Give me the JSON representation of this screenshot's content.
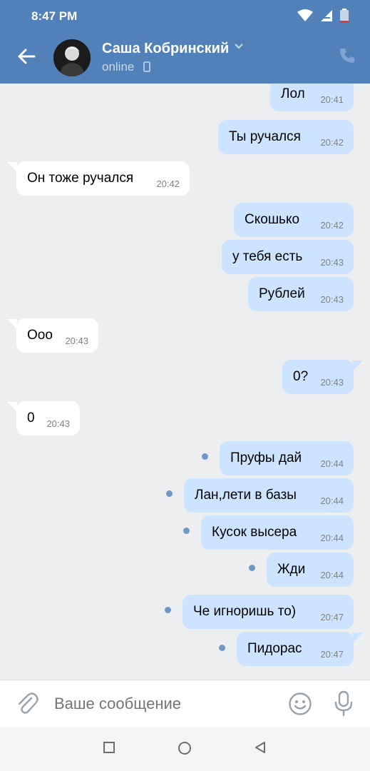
{
  "status": {
    "time": "8:47 PM"
  },
  "header": {
    "name": "Саша Кобринский",
    "status": "online"
  },
  "messages": [
    {
      "text": "Лол",
      "time": "20:41",
      "dir": "out"
    },
    {
      "text": "Ты ручался",
      "time": "20:42",
      "dir": "out"
    },
    {
      "text": "Он тоже ручался",
      "time": "20:42",
      "dir": "in"
    },
    {
      "text": "Скошько",
      "time": "20:42",
      "dir": "out"
    },
    {
      "text": "у тебя есть",
      "time": "20:43",
      "dir": "out"
    },
    {
      "text": "Рублей",
      "time": "20:43",
      "dir": "out"
    },
    {
      "text": "Ооо",
      "time": "20:43",
      "dir": "in"
    },
    {
      "text": "0?",
      "time": "20:43",
      "dir": "out"
    },
    {
      "text": "0",
      "time": "20:43",
      "dir": "in"
    },
    {
      "text": "Пруфы дай",
      "time": "20:44",
      "dir": "out",
      "unread": true
    },
    {
      "text": "Лан,лети в базы",
      "time": "20:44",
      "dir": "out",
      "unread": true
    },
    {
      "text": "Кусок высера",
      "time": "20:44",
      "dir": "out",
      "unread": true
    },
    {
      "text": "Жди",
      "time": "20:44",
      "dir": "out",
      "unread": true
    },
    {
      "text": "Че игноришь то)",
      "time": "20:47",
      "dir": "out",
      "unread": true
    },
    {
      "text": "Пидорас",
      "time": "20:47",
      "dir": "out",
      "unread": true
    }
  ],
  "compose": {
    "placeholder": "Ваше сообщение"
  },
  "icons": {
    "back": "arrow-left-icon",
    "call": "phone-icon",
    "attach": "paperclip-icon",
    "emoji": "smile-icon",
    "mic": "microphone-icon"
  },
  "colors": {
    "header": "#5181b8",
    "outgoing": "#cce4ff",
    "incoming": "#ffffff",
    "background": "#edeef0",
    "unread_dot": "#7097c6"
  }
}
